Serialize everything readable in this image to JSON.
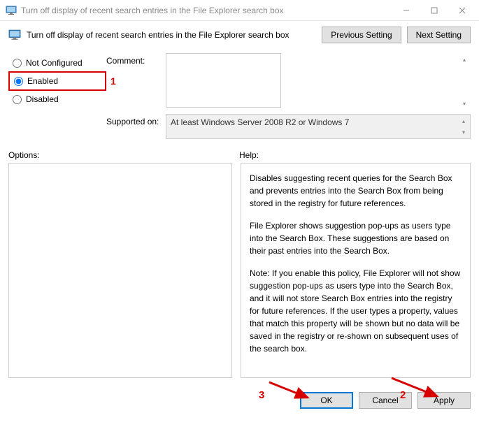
{
  "window": {
    "title": "Turn off display of recent search entries in the File Explorer search box"
  },
  "header": {
    "policy_title": "Turn off display of recent search entries in the File Explorer search box",
    "prev_btn": "Previous Setting",
    "next_btn": "Next Setting"
  },
  "radios": {
    "not_configured": "Not Configured",
    "enabled": "Enabled",
    "disabled": "Disabled"
  },
  "annotations": {
    "n1": "1",
    "n2": "2",
    "n3": "3"
  },
  "fields": {
    "comment_label": "Comment:",
    "comment_value": "",
    "supported_label": "Supported on:",
    "supported_value": "At least Windows Server 2008 R2 or Windows 7"
  },
  "panels": {
    "options_label": "Options:",
    "help_label": "Help:"
  },
  "help": {
    "p1": "Disables suggesting recent queries for the Search Box and prevents entries into the Search Box from being stored in the registry for future references.",
    "p2": "File Explorer shows suggestion pop-ups as users type into the Search Box.  These suggestions are based on their past entries into the Search Box.",
    "p3": "Note: If you enable this policy, File Explorer will not show suggestion pop-ups as users type into the Search Box, and it will not store Search Box entries into the registry for future references.  If the user types a property, values that match this property will be shown but no data will be saved in the registry or re-shown on subsequent uses of the search box."
  },
  "footer": {
    "ok": "OK",
    "cancel": "Cancel",
    "apply": "Apply"
  }
}
